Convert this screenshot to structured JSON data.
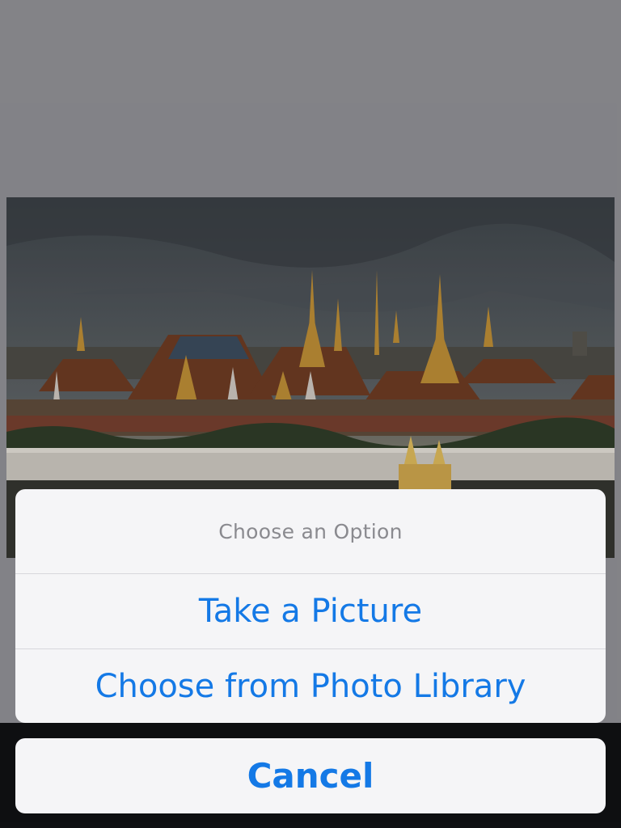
{
  "photo": {
    "description_icon": "photo-image"
  },
  "action_sheet": {
    "title": "Choose an Option",
    "options": [
      {
        "label": "Take a Picture"
      },
      {
        "label": "Choose from Photo Library"
      }
    ],
    "cancel_label": "Cancel"
  },
  "toolbar": {
    "icons": [
      "photos-icon",
      "frame-icon",
      "share-icon"
    ]
  },
  "colors": {
    "accent": "#1479e6",
    "sheet_bg": "#f5f5f7",
    "backdrop": "#8e8e93",
    "toolbar": "#101113"
  }
}
